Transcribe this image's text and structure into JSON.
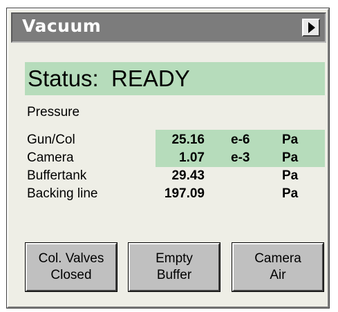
{
  "window": {
    "title": "Vacuum",
    "menu_icon": "triangle-right-icon"
  },
  "status": {
    "text": "Status:  READY"
  },
  "pressure": {
    "heading": "Pressure",
    "rows": [
      {
        "label": "Gun/Col",
        "value": "25.16",
        "exponent": "e-6",
        "unit": "Pa",
        "highlighted": true
      },
      {
        "label": "Camera",
        "value": "1.07",
        "exponent": "e-3",
        "unit": "Pa",
        "highlighted": true
      },
      {
        "label": "Buffertank",
        "value": "29.43",
        "exponent": "",
        "unit": "Pa",
        "highlighted": false
      },
      {
        "label": "Backing line",
        "value": "197.09",
        "exponent": "",
        "unit": "Pa",
        "highlighted": false
      }
    ]
  },
  "buttons": {
    "col_valves": {
      "line1": "Col. Valves",
      "line2": "Closed"
    },
    "empty_buffer": {
      "line1": "Empty",
      "line2": "Buffer"
    },
    "camera_air": {
      "line1": "Camera",
      "line2": "Air"
    }
  },
  "colors": {
    "highlight": "#b6dcbb",
    "panel": "#eeeee6",
    "titlebar": "#7c7c7c",
    "button": "#c0c0c0"
  }
}
